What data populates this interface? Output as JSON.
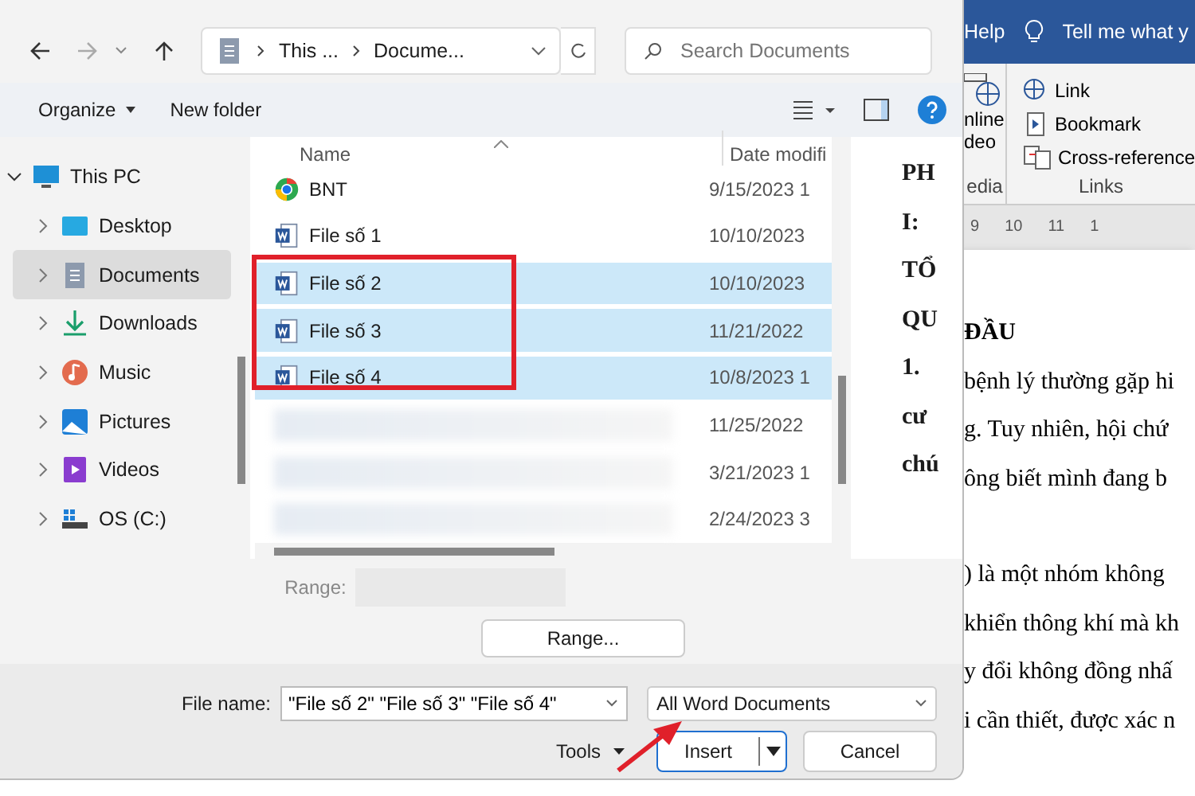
{
  "dialog": {
    "nav": {
      "path": [
        "This ...",
        "Docume..."
      ],
      "search_placeholder": "Search Documents"
    },
    "toolbar": {
      "organize": "Organize",
      "new_folder": "New folder"
    },
    "sidebar": {
      "items": [
        {
          "label": "This PC",
          "kind": "pc",
          "expanded": true,
          "selected": false,
          "children": [
            {
              "label": "Desktop",
              "kind": "desktop",
              "expanded": false,
              "selected": false
            },
            {
              "label": "Documents",
              "kind": "documents",
              "expanded": false,
              "selected": true
            },
            {
              "label": "Downloads",
              "kind": "downloads",
              "expanded": false,
              "selected": false
            },
            {
              "label": "Music",
              "kind": "music",
              "expanded": false,
              "selected": false
            },
            {
              "label": "Pictures",
              "kind": "pictures",
              "expanded": false,
              "selected": false
            },
            {
              "label": "Videos",
              "kind": "videos",
              "expanded": false,
              "selected": false
            },
            {
              "label": "OS (C:)",
              "kind": "drive",
              "expanded": false,
              "selected": false
            }
          ]
        }
      ]
    },
    "file_list": {
      "columns": [
        "Name",
        "Date modifi"
      ],
      "rows": [
        {
          "kind": "chrome",
          "name": "BNT",
          "date": "9/15/2023 1",
          "selected": false
        },
        {
          "kind": "word",
          "name": "File số 1",
          "date": "10/10/2023",
          "selected": false
        },
        {
          "kind": "word",
          "name": "File số 2",
          "date": "10/10/2023",
          "selected": true
        },
        {
          "kind": "word",
          "name": "File số 3",
          "date": "11/21/2022",
          "selected": true
        },
        {
          "kind": "word",
          "name": "File số 4",
          "date": "10/8/2023 1",
          "selected": true
        },
        {
          "kind": "blurred",
          "date": "11/25/2022",
          "selected": false
        },
        {
          "kind": "blurred",
          "date": "3/21/2023 1",
          "selected": false
        },
        {
          "kind": "blurred",
          "date": "2/24/2023 3",
          "selected": false
        }
      ]
    },
    "preview": {
      "lines": [
        "PH",
        "I:",
        "TỔ",
        "QU",
        "1.",
        "cư",
        "chú"
      ]
    },
    "range": {
      "label": "Range:",
      "button": "Range..."
    },
    "file_name": {
      "label": "File name:",
      "value": "\"File số 2\" \"File số 3\" \"File số 4\""
    },
    "file_type": "All Word Documents",
    "buttons": {
      "tools": "Tools",
      "insert": "Insert",
      "cancel": "Cancel"
    }
  },
  "word": {
    "tab": "Help",
    "tell_me": "Tell me what y",
    "media": {
      "items": [
        "nline",
        "deo"
      ],
      "group": "edia"
    },
    "links": {
      "items": [
        "Link",
        "Bookmark",
        "Cross-reference"
      ],
      "group": "Links"
    },
    "ruler": [
      "9",
      "10",
      "11",
      "1"
    ],
    "heading": "ĐẦU",
    "lines": [
      "bệnh lý thường gặp hi",
      "g. Tuy nhiên, hội chứ",
      "ông biết mình đang b",
      ") là một nhóm không",
      "khiển thông khí mà kh",
      "y đổi không đồng nhấ",
      "i cần thiết, được xác n"
    ]
  }
}
